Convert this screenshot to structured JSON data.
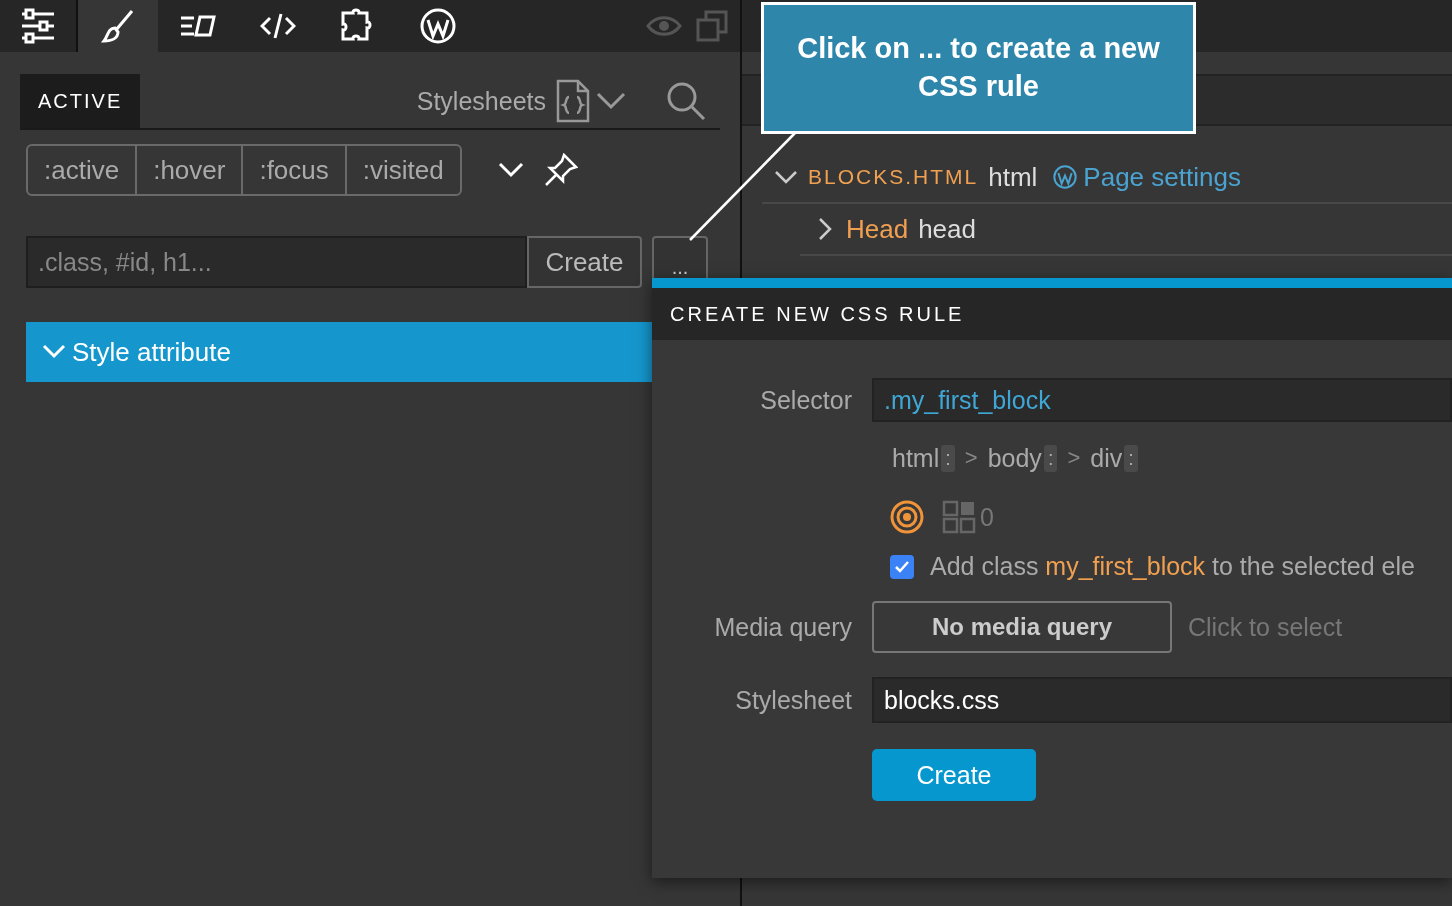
{
  "toolbar": {
    "tabs": [
      {
        "kind": "sliders",
        "selected": false
      },
      {
        "kind": "brush",
        "selected": true
      },
      {
        "kind": "text-box",
        "selected": false
      },
      {
        "kind": "code",
        "selected": false
      },
      {
        "kind": "puzzle",
        "selected": false
      },
      {
        "kind": "wordpress",
        "selected": false
      }
    ]
  },
  "style_panel": {
    "tabs": [
      {
        "label": "ACTIVE",
        "selected": true
      }
    ],
    "stylesheets_label": "Stylesheets",
    "pseudo_classes": [
      ":active",
      ":hover",
      ":focus",
      ":visited"
    ],
    "selector_field": {
      "placeholder": ".class, #id, h1..."
    },
    "create_button": "Create",
    "more_button": "...",
    "sections": [
      {
        "label": "Style attribute",
        "expanded": true
      }
    ]
  },
  "tree": {
    "root": {
      "name": "BLOCKS.HTML",
      "tag": "html",
      "link": "Page settings",
      "expanded": true,
      "children": [
        {
          "name": "Head",
          "tag": "head",
          "expanded": false
        }
      ]
    }
  },
  "dialog": {
    "title": "CREATE NEW CSS RULE",
    "selector_label": "Selector",
    "selector_value": ".my_first_block",
    "crumbs": [
      {
        "kind": "tag",
        "text": "html",
        "badge": ":"
      },
      {
        "kind": "separator",
        "text": ">"
      },
      {
        "kind": "tag",
        "text": "body",
        "badge": ":"
      },
      {
        "kind": "separator",
        "text": ">"
      },
      {
        "kind": "tag",
        "text": "div",
        "badge": ":"
      }
    ],
    "match_count": "0",
    "add_class": {
      "checked": true,
      "prefix": "Add class",
      "class_name": "my_first_block",
      "suffix": "to the selected ele"
    },
    "media_label": "Media query",
    "media_button": "No media query",
    "media_hint": "Click to select",
    "stylesheet_label": "Stylesheet",
    "stylesheet_value": "blocks.css",
    "create_button": "Create"
  },
  "callout": {
    "text": "Click on ... to create a new CSS rule"
  }
}
